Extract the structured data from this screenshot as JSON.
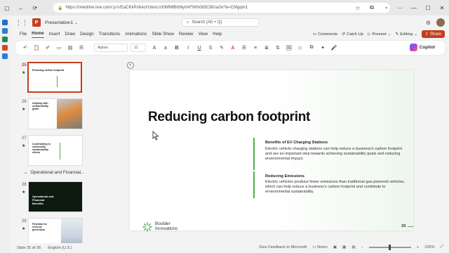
{
  "browser": {
    "url": "https://onedrive.live.com/:p:/r/EaCKkPs6AcHJwxLn306fMlBrb9yrlAFWfx0b5C8iUa2w?e=CMgqm1"
  },
  "office": {
    "doc_title": "Presentation1",
    "search_placeholder": "Search (Alt + Q)"
  },
  "ribbon": {
    "tabs": [
      "File",
      "Home",
      "Insert",
      "Draw",
      "Design",
      "Transitions",
      "Animations",
      "Slide Show",
      "Review",
      "View",
      "Help"
    ],
    "active_tab": "Home",
    "comments_label": "Comments",
    "catchup_label": "Catch Up",
    "present_label": "Present",
    "editing_label": "Editing",
    "share_label": "Share",
    "font_name": "Aptos",
    "font_size": "11",
    "copilot_label": "Copilot"
  },
  "thumbnails": [
    {
      "num": "25",
      "title": "Reducing carbon footprint",
      "active": true
    },
    {
      "num": "26",
      "title": "Aligning with sustainability goals",
      "active": false
    },
    {
      "num": "27",
      "title": "Contributing to community sustainability efforts",
      "active": false
    },
    {
      "num": "28",
      "title": "Operational and Financial Benefits",
      "active": false
    },
    {
      "num": "29",
      "title": "Potential for revenue generation",
      "active": false
    }
  ],
  "section_label": "Operational and Financial...",
  "slide": {
    "title": "Reducing carbon footprint",
    "point1_head": "Benefits of EV Charging Stations",
    "point1_body": "Electric vehicle charging stations can help reduce a business's carbon footprint and are an important step towards achieving sustainability goals and reducing environmental impact.",
    "point2_head": "Reducing Emissions",
    "point2_body": "Electric vehicles produce fewer emissions than traditional gas-powered vehicles, which can help reduce a business's carbon footprint and contribute to environmental sustainability.",
    "logo_line1": "Boulder",
    "logo_line2": "Innovations",
    "slide_number": "25"
  },
  "status": {
    "slide_of": "Slide 25 of 36",
    "language": "English (U.S.)",
    "feedback": "Give Feedback to Microsoft",
    "notes_label": "Notes",
    "zoom": "105%"
  },
  "colors": {
    "accent": "#c43e1c",
    "green": "#4cae4c"
  }
}
